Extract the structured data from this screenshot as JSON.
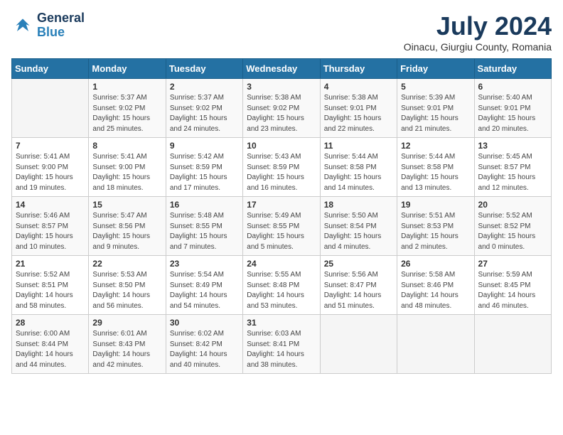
{
  "header": {
    "logo_line1": "General",
    "logo_line2": "Blue",
    "month_year": "July 2024",
    "location": "Oinacu, Giurgiu County, Romania"
  },
  "days_of_week": [
    "Sunday",
    "Monday",
    "Tuesday",
    "Wednesday",
    "Thursday",
    "Friday",
    "Saturday"
  ],
  "weeks": [
    [
      {
        "day": "",
        "info": ""
      },
      {
        "day": "1",
        "info": "Sunrise: 5:37 AM\nSunset: 9:02 PM\nDaylight: 15 hours\nand 25 minutes."
      },
      {
        "day": "2",
        "info": "Sunrise: 5:37 AM\nSunset: 9:02 PM\nDaylight: 15 hours\nand 24 minutes."
      },
      {
        "day": "3",
        "info": "Sunrise: 5:38 AM\nSunset: 9:02 PM\nDaylight: 15 hours\nand 23 minutes."
      },
      {
        "day": "4",
        "info": "Sunrise: 5:38 AM\nSunset: 9:01 PM\nDaylight: 15 hours\nand 22 minutes."
      },
      {
        "day": "5",
        "info": "Sunrise: 5:39 AM\nSunset: 9:01 PM\nDaylight: 15 hours\nand 21 minutes."
      },
      {
        "day": "6",
        "info": "Sunrise: 5:40 AM\nSunset: 9:01 PM\nDaylight: 15 hours\nand 20 minutes."
      }
    ],
    [
      {
        "day": "7",
        "info": "Sunrise: 5:41 AM\nSunset: 9:00 PM\nDaylight: 15 hours\nand 19 minutes."
      },
      {
        "day": "8",
        "info": "Sunrise: 5:41 AM\nSunset: 9:00 PM\nDaylight: 15 hours\nand 18 minutes."
      },
      {
        "day": "9",
        "info": "Sunrise: 5:42 AM\nSunset: 8:59 PM\nDaylight: 15 hours\nand 17 minutes."
      },
      {
        "day": "10",
        "info": "Sunrise: 5:43 AM\nSunset: 8:59 PM\nDaylight: 15 hours\nand 16 minutes."
      },
      {
        "day": "11",
        "info": "Sunrise: 5:44 AM\nSunset: 8:58 PM\nDaylight: 15 hours\nand 14 minutes."
      },
      {
        "day": "12",
        "info": "Sunrise: 5:44 AM\nSunset: 8:58 PM\nDaylight: 15 hours\nand 13 minutes."
      },
      {
        "day": "13",
        "info": "Sunrise: 5:45 AM\nSunset: 8:57 PM\nDaylight: 15 hours\nand 12 minutes."
      }
    ],
    [
      {
        "day": "14",
        "info": "Sunrise: 5:46 AM\nSunset: 8:57 PM\nDaylight: 15 hours\nand 10 minutes."
      },
      {
        "day": "15",
        "info": "Sunrise: 5:47 AM\nSunset: 8:56 PM\nDaylight: 15 hours\nand 9 minutes."
      },
      {
        "day": "16",
        "info": "Sunrise: 5:48 AM\nSunset: 8:55 PM\nDaylight: 15 hours\nand 7 minutes."
      },
      {
        "day": "17",
        "info": "Sunrise: 5:49 AM\nSunset: 8:55 PM\nDaylight: 15 hours\nand 5 minutes."
      },
      {
        "day": "18",
        "info": "Sunrise: 5:50 AM\nSunset: 8:54 PM\nDaylight: 15 hours\nand 4 minutes."
      },
      {
        "day": "19",
        "info": "Sunrise: 5:51 AM\nSunset: 8:53 PM\nDaylight: 15 hours\nand 2 minutes."
      },
      {
        "day": "20",
        "info": "Sunrise: 5:52 AM\nSunset: 8:52 PM\nDaylight: 15 hours\nand 0 minutes."
      }
    ],
    [
      {
        "day": "21",
        "info": "Sunrise: 5:52 AM\nSunset: 8:51 PM\nDaylight: 14 hours\nand 58 minutes."
      },
      {
        "day": "22",
        "info": "Sunrise: 5:53 AM\nSunset: 8:50 PM\nDaylight: 14 hours\nand 56 minutes."
      },
      {
        "day": "23",
        "info": "Sunrise: 5:54 AM\nSunset: 8:49 PM\nDaylight: 14 hours\nand 54 minutes."
      },
      {
        "day": "24",
        "info": "Sunrise: 5:55 AM\nSunset: 8:48 PM\nDaylight: 14 hours\nand 53 minutes."
      },
      {
        "day": "25",
        "info": "Sunrise: 5:56 AM\nSunset: 8:47 PM\nDaylight: 14 hours\nand 51 minutes."
      },
      {
        "day": "26",
        "info": "Sunrise: 5:58 AM\nSunset: 8:46 PM\nDaylight: 14 hours\nand 48 minutes."
      },
      {
        "day": "27",
        "info": "Sunrise: 5:59 AM\nSunset: 8:45 PM\nDaylight: 14 hours\nand 46 minutes."
      }
    ],
    [
      {
        "day": "28",
        "info": "Sunrise: 6:00 AM\nSunset: 8:44 PM\nDaylight: 14 hours\nand 44 minutes."
      },
      {
        "day": "29",
        "info": "Sunrise: 6:01 AM\nSunset: 8:43 PM\nDaylight: 14 hours\nand 42 minutes."
      },
      {
        "day": "30",
        "info": "Sunrise: 6:02 AM\nSunset: 8:42 PM\nDaylight: 14 hours\nand 40 minutes."
      },
      {
        "day": "31",
        "info": "Sunrise: 6:03 AM\nSunset: 8:41 PM\nDaylight: 14 hours\nand 38 minutes."
      },
      {
        "day": "",
        "info": ""
      },
      {
        "day": "",
        "info": ""
      },
      {
        "day": "",
        "info": ""
      }
    ]
  ]
}
